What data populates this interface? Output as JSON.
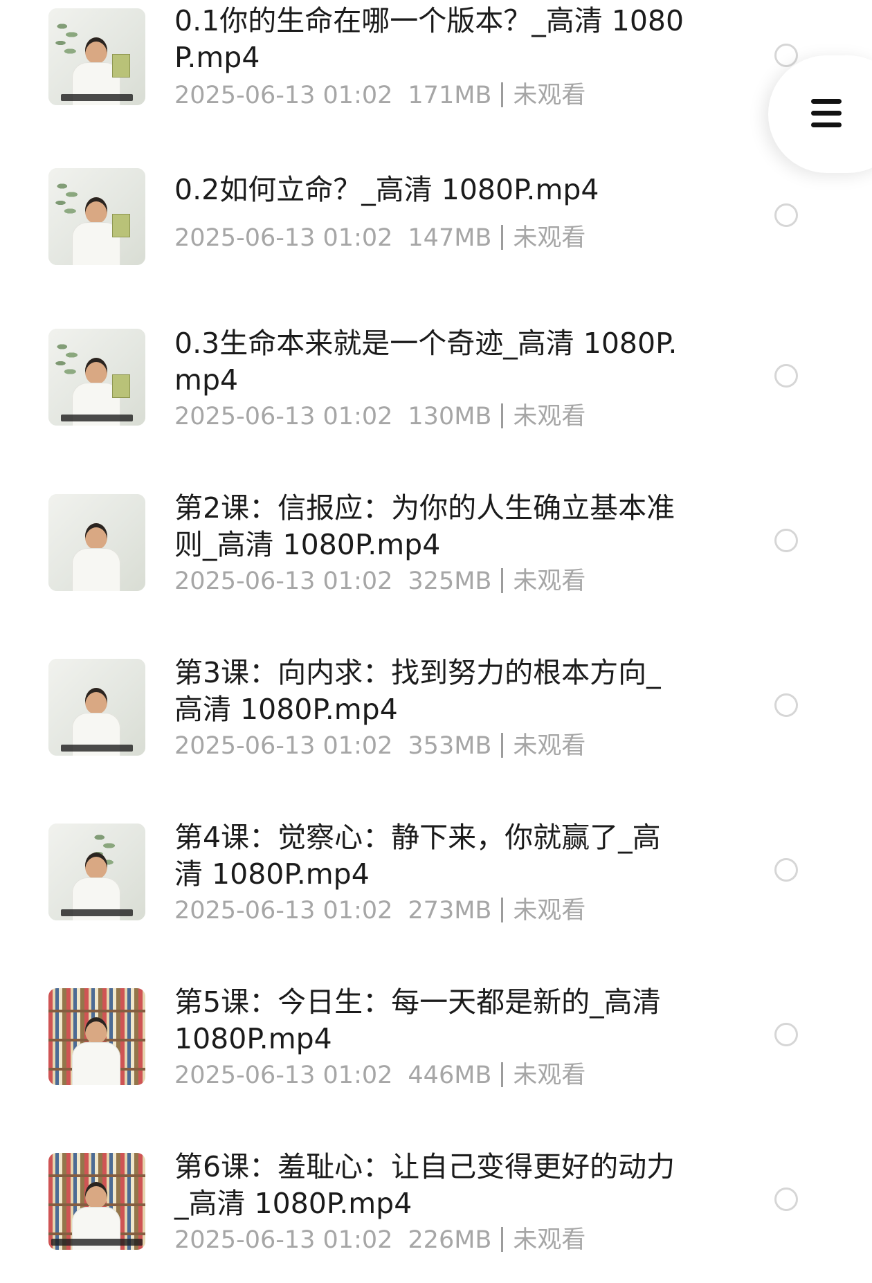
{
  "files": [
    {
      "title": "0.1你的生命在哪一个版本？_高清 1080P.mp4",
      "date": "2025-06-13 01:02",
      "size": "171MB",
      "status": "未观看",
      "thumbnail": "video-thumbnail-presenter-with-book"
    },
    {
      "title": "0.2如何立命？_高清 1080P.mp4",
      "date": "2025-06-13 01:02",
      "size": "147MB",
      "status": "未观看",
      "thumbnail": "video-thumbnail-presenter-with-book"
    },
    {
      "title": "0.3生命本来就是一个奇迹_高清 1080P.mp4",
      "date": "2025-06-13 01:02",
      "size": "130MB",
      "status": "未观看",
      "thumbnail": "video-thumbnail-presenter-with-book"
    },
    {
      "title": "第2课：信报应：为你的人生确立基本准则_高清 1080P.mp4",
      "date": "2025-06-13 01:02",
      "size": "325MB",
      "status": "未观看",
      "thumbnail": "video-thumbnail-presenter"
    },
    {
      "title": "第3课：向内求：找到努力的根本方向_高清 1080P.mp4",
      "date": "2025-06-13 01:02",
      "size": "353MB",
      "status": "未观看",
      "thumbnail": "video-thumbnail-presenter"
    },
    {
      "title": "第4课：觉察心：静下来，你就赢了_高清 1080P.mp4",
      "date": "2025-06-13 01:02",
      "size": "273MB",
      "status": "未观看",
      "thumbnail": "video-thumbnail-presenter-bamboo"
    },
    {
      "title": "第5课：今日生：每一天都是新的_高清 1080P.mp4",
      "date": "2025-06-13 01:02",
      "size": "446MB",
      "status": "未观看",
      "thumbnail": "video-thumbnail-presenter-bookshelf"
    },
    {
      "title": "第6课：羞耻心：让自己变得更好的动力_高清 1080P.mp4",
      "date": "2025-06-13 01:02",
      "size": "226MB",
      "status": "未观看",
      "thumbnail": "video-thumbnail-presenter-bookshelf"
    }
  ],
  "floating_menu": {
    "icon": "hamburger-menu-icon"
  },
  "colors": {
    "title_text": "#1b1b1b",
    "meta_text": "#a6a6a6",
    "radio_border": "#d6d6d6",
    "background": "#ffffff"
  }
}
